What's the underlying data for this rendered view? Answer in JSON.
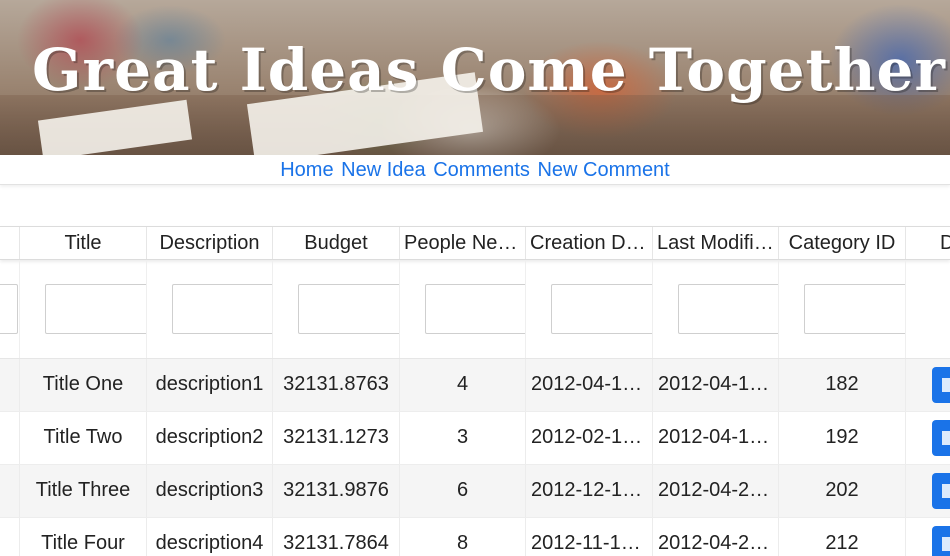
{
  "banner": {
    "title": "Great Ideas Come Together"
  },
  "nav": {
    "items": [
      {
        "label": "Home"
      },
      {
        "label": "New Idea"
      },
      {
        "label": "Comments"
      },
      {
        "label": "New Comment"
      }
    ]
  },
  "grid": {
    "columns": [
      "",
      "Title",
      "Description",
      "Budget",
      "People Needed",
      "Creation Date",
      "Last Modified",
      "Category ID",
      "D"
    ],
    "rows": [
      {
        "title": "Title One",
        "description": "description1",
        "budget": "32131.8763",
        "people": "4",
        "created": "2012-04-1…",
        "modified": "2012-04-1…",
        "category": "182"
      },
      {
        "title": "Title Two",
        "description": "description2",
        "budget": "32131.1273",
        "people": "3",
        "created": "2012-02-1…",
        "modified": "2012-04-1…",
        "category": "192"
      },
      {
        "title": "Title Three",
        "description": "description3",
        "budget": "32131.9876",
        "people": "6",
        "created": "2012-12-1…",
        "modified": "2012-04-2…",
        "category": "202"
      },
      {
        "title": "Title Four",
        "description": "description4",
        "budget": "32131.7864",
        "people": "8",
        "created": "2012-11-1…",
        "modified": "2012-04-2…",
        "category": "212"
      }
    ]
  },
  "colors": {
    "link": "#1a73e8",
    "action_button": "#1a73e8",
    "odd_row": "#f5f5f5"
  }
}
